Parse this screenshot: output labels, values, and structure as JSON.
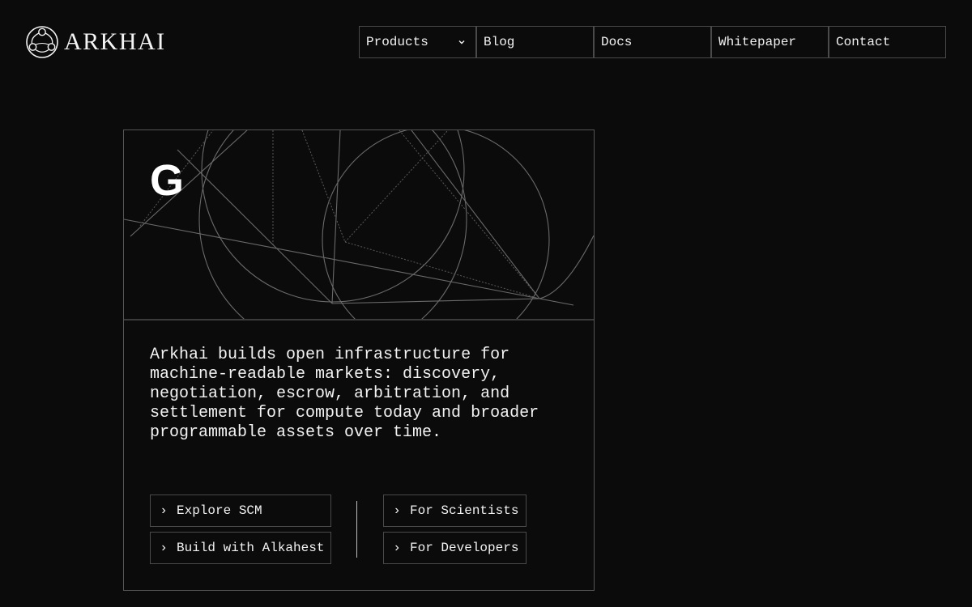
{
  "brand": {
    "name": "ARKHAI"
  },
  "nav": {
    "items": [
      {
        "label": "Products",
        "has_dropdown": true,
        "icon": "chevron-down-icon"
      },
      {
        "label": "Blog"
      },
      {
        "label": "Docs"
      },
      {
        "label": "Whitepaper"
      },
      {
        "label": "Contact"
      }
    ]
  },
  "hero": {
    "glyph": "G",
    "description": "Arkhai builds open infrastructure for machine-readable markets: discovery, negotiation, escrow, arbitration, and settlement for compute today and broader programmable assets over time.",
    "actions_left": [
      {
        "label": "Explore SCM",
        "icon": "chevron-right-icon"
      },
      {
        "label": "Build with Alkahest",
        "icon": "chevron-right-icon"
      }
    ],
    "actions_right": [
      {
        "label": "For Scientists",
        "icon": "chevron-right-icon"
      },
      {
        "label": "For Developers",
        "icon": "chevron-right-icon"
      }
    ]
  },
  "colors": {
    "background": "#0b0b0b",
    "text": "#f2f2f2",
    "border": "#4a4a4a"
  }
}
